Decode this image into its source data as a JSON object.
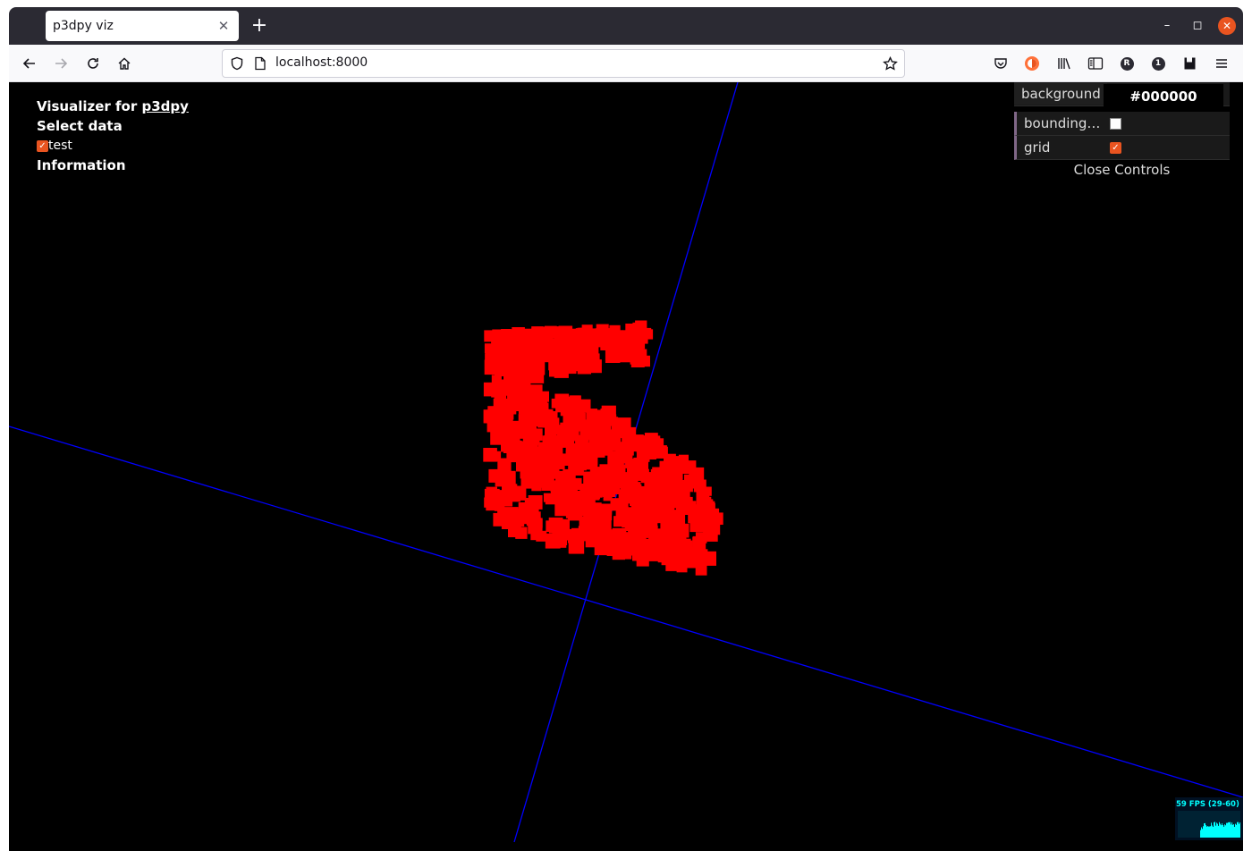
{
  "browser": {
    "tab_title": "p3dpy viz",
    "tab_close_glyph": "✕",
    "new_tab_glyph": "+",
    "url": "localhost:8000",
    "window_controls": {
      "minimize": "–",
      "maximize": "◻",
      "close": "✕"
    }
  },
  "info": {
    "title_prefix": "Visualizer for ",
    "title_link": "p3dpy",
    "select_data": "Select data",
    "dataset_label": "test",
    "dataset_checked": true,
    "information": "Information"
  },
  "controls": {
    "background_label": "background",
    "background_value": "#000000",
    "bounding_label": "bounding…",
    "bounding_checked": false,
    "grid_label": "grid",
    "grid_checked": true,
    "close_label": "Close Controls"
  },
  "fps_meter": {
    "text": "59 FPS (29-60)"
  },
  "scene": {
    "point_color": "#ff0000",
    "axis_color": "#0000ff",
    "background_color": "#000000"
  },
  "icons": [
    "back-icon",
    "forward-icon",
    "reload-icon",
    "home-icon",
    "shield-icon",
    "page-icon",
    "star-icon",
    "pocket-icon",
    "firefox-account-icon",
    "library-icon",
    "sidebar-icon",
    "extension-r-icon",
    "extension-1-icon",
    "save-icon",
    "menu-icon"
  ]
}
